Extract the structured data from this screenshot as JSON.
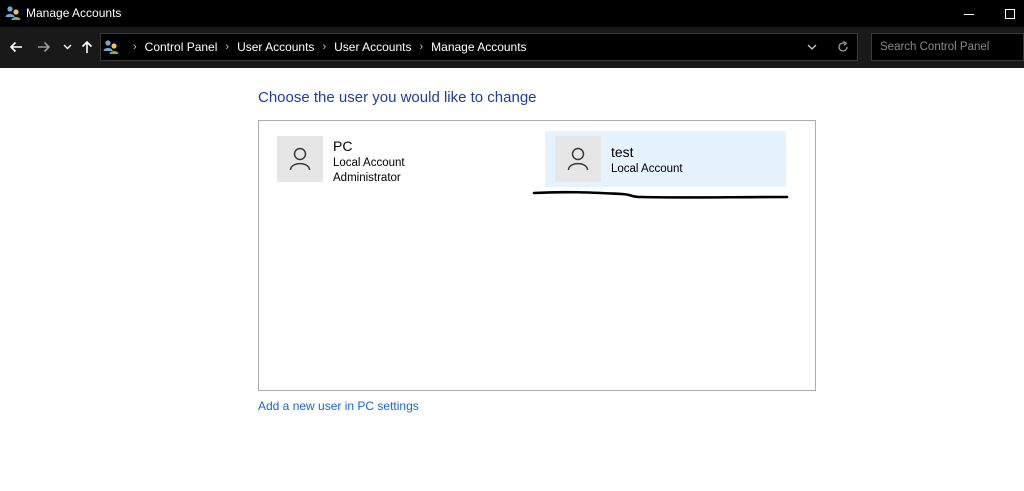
{
  "window": {
    "title": "Manage Accounts",
    "icon": "user-accounts-icon"
  },
  "navigation": {
    "breadcrumbs": [
      "Control Panel",
      "User Accounts",
      "User Accounts",
      "Manage Accounts"
    ],
    "search_placeholder": "Search Control Panel"
  },
  "main": {
    "heading": "Choose the user you would like to change",
    "accounts": [
      {
        "name": "PC",
        "type": "Local Account",
        "role": "Administrator"
      },
      {
        "name": "test",
        "type": "Local Account",
        "role": ""
      }
    ],
    "add_user_link": "Add a new user in PC settings"
  },
  "colors": {
    "heading": "#1e3e9a",
    "link": "#1a66c8",
    "selected_tile": "#e5f3fe",
    "avatar_bg": "#e6e6e6",
    "titlebar": "#000000",
    "navbar": "#191919",
    "annotation": "#000000"
  }
}
